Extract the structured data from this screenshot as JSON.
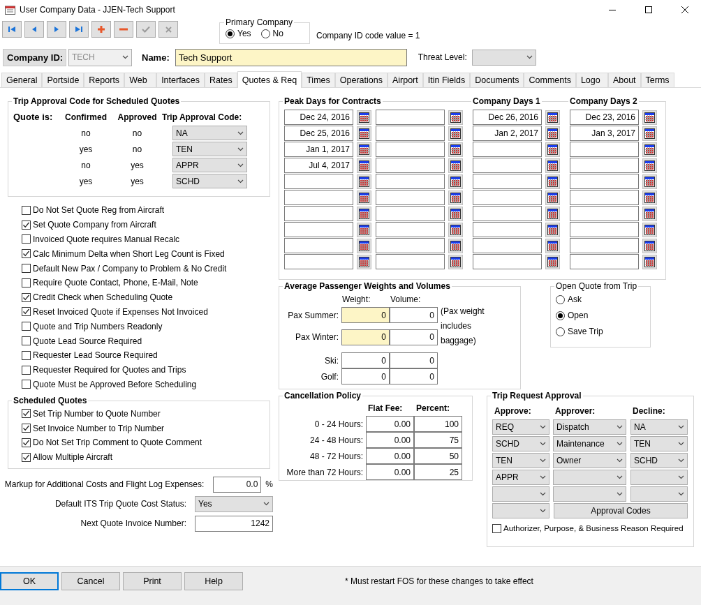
{
  "window": {
    "title": "User Company Data - JJEN-Tech Support"
  },
  "toolbar": [
    {
      "kind": "first",
      "disabled": false
    },
    {
      "kind": "previous",
      "disabled": false
    },
    {
      "kind": "next",
      "disabled": false
    },
    {
      "kind": "last",
      "disabled": false
    },
    {
      "kind": "add",
      "disabled": false
    },
    {
      "kind": "delete",
      "disabled": false
    },
    {
      "kind": "save",
      "disabled": true
    },
    {
      "kind": "cancel",
      "disabled": true
    }
  ],
  "primary_company": {
    "title": "Primary Company",
    "options": [
      {
        "label": "Yes",
        "selected": true
      },
      {
        "label": "No",
        "selected": false
      }
    ]
  },
  "company_id_code": "Company ID code value = 1",
  "company_id": {
    "label": "Company ID:",
    "value": "TECH",
    "disabled": true
  },
  "name": {
    "label": "Name:",
    "value": "Tech Support"
  },
  "threat_level": {
    "label": "Threat Level:"
  },
  "tabs": [
    {
      "label": "General",
      "selected": false
    },
    {
      "label": "Portside",
      "selected": false
    },
    {
      "label": "Reports",
      "selected": false
    },
    {
      "label": "Web",
      "selected": false
    },
    {
      "label": "Interfaces",
      "selected": false
    },
    {
      "label": "Rates",
      "selected": false
    },
    {
      "label": "Quotes & Req",
      "selected": true
    },
    {
      "label": "Times",
      "selected": false
    },
    {
      "label": "Operations",
      "selected": false
    },
    {
      "label": "Airport",
      "selected": false
    },
    {
      "label": "Itin Fields",
      "selected": false
    },
    {
      "label": "Documents",
      "selected": false
    },
    {
      "label": "Comments",
      "selected": false
    },
    {
      "label": "Logo",
      "selected": false
    },
    {
      "label": "About",
      "selected": false
    },
    {
      "label": "Terms",
      "selected": false
    }
  ],
  "trip_approval": {
    "title": "Trip Approval Code for Scheduled Quotes",
    "headers": [
      "Quote is:",
      "Confirmed",
      "Approved",
      "Trip Approval Code:"
    ],
    "rows": [
      {
        "confirmed": "no",
        "approved": "no",
        "code": "NA"
      },
      {
        "confirmed": "yes",
        "approved": "no",
        "code": "TEN"
      },
      {
        "confirmed": "no",
        "approved": "yes",
        "code": "APPR"
      },
      {
        "confirmed": "yes",
        "approved": "yes",
        "code": "SCHD"
      }
    ]
  },
  "options": [
    {
      "label": "Do Not Set Quote Reg from Aircraft",
      "checked": false
    },
    {
      "label": "Set Quote Company from Aircraft",
      "checked": true
    },
    {
      "label": "Invoiced Quote requires Manual Recalc",
      "checked": false
    },
    {
      "label": "Calc Minimum Delta when Short Leg Count is Fixed",
      "checked": true
    },
    {
      "label": "Default New Pax / Company to Problem & No Credit",
      "checked": false
    },
    {
      "label": "Require Quote Contact, Phone, E-Mail, Note",
      "checked": false
    },
    {
      "label": "Credit Check when Scheduling Quote",
      "checked": true
    },
    {
      "label": "Reset Invoiced Quote if Expenses Not Invoiced",
      "checked": true
    },
    {
      "label": "Quote and Trip Numbers Readonly",
      "checked": false
    },
    {
      "label": "Quote Lead Source Required",
      "checked": false
    },
    {
      "label": "Requester Lead Source Required",
      "checked": false
    },
    {
      "label": "Requester Required for Quotes and Trips",
      "checked": false
    },
    {
      "label": "Quote Must be Approved Before Scheduling",
      "checked": false
    }
  ],
  "scheduled_quotes": {
    "title": "Scheduled Quotes",
    "options": [
      {
        "label": "Set Trip Number to Quote Number",
        "checked": true
      },
      {
        "label": "Set Invoice Number to Trip Number",
        "checked": true
      },
      {
        "label": "Do Not Set Trip Comment to Quote Comment",
        "checked": true
      },
      {
        "label": "Allow Multiple Aircraft",
        "checked": true
      }
    ]
  },
  "markup": {
    "label": "Markup for Additional Costs and Flight Log Expenses:",
    "value": "0.0",
    "unit": "%"
  },
  "default_its_status": {
    "label": "Default ITS Trip Quote Cost Status:",
    "value": "Yes"
  },
  "next_invoice": {
    "label": "Next Quote Invoice Number:",
    "value": "1242"
  },
  "day_groups": [
    {
      "title": "Peak Days for Contracts",
      "columns": [
        {
          "kind": "dates",
          "dates": [
            "Dec 24, 2016",
            "Dec 25, 2016",
            "Jan 1, 2017",
            "Jul 4, 2017"
          ]
        },
        {
          "kind": "dates"
        }
      ]
    },
    {
      "title": "Company Days 1",
      "columns": [
        {
          "kind": "dates",
          "dates": [
            "Dec 26, 2016",
            "Jan 2, 2017"
          ]
        }
      ]
    },
    {
      "title": "Company Days 2",
      "columns": [
        {
          "kind": "dates",
          "dates": [
            "Dec 23, 2016",
            "Jan 3, 2017"
          ]
        }
      ]
    }
  ],
  "passenger_weights": {
    "title": "Average Passenger Weights and Volumes",
    "headers": [
      "Weight:",
      "Volume:"
    ],
    "note": "(Pax weight includes baggage)",
    "rows": [
      {
        "label": "Pax Summer:",
        "weight": "0",
        "volume": "0",
        "highlighted": true
      },
      {
        "label": "Pax Winter:",
        "weight": "0",
        "volume": "0",
        "highlighted": true
      },
      {
        "label": "Ski:",
        "weight": "0",
        "volume": "0",
        "highlighted": false
      },
      {
        "label": "Golf:",
        "weight": "0",
        "volume": "0",
        "highlighted": false
      }
    ]
  },
  "open_quote": {
    "title": "Open Quote from Trip",
    "options": [
      {
        "label": "Ask",
        "selected": false
      },
      {
        "label": "Open",
        "selected": true
      },
      {
        "label": "Save Trip",
        "selected": false
      }
    ]
  },
  "cancellation": {
    "title": "Cancellation Policy",
    "headers": [
      "Flat Fee:",
      "Percent:"
    ],
    "rows": [
      {
        "label": "0 - 24 Hours:",
        "fee": "0.00",
        "percent": "100"
      },
      {
        "label": "24 - 48 Hours:",
        "fee": "0.00",
        "percent": "75"
      },
      {
        "label": "48 -  72 Hours:",
        "fee": "0.00",
        "percent": "50"
      },
      {
        "label": "More than 72 Hours:",
        "fee": "0.00",
        "percent": "25"
      }
    ]
  },
  "trip_request": {
    "title": "Trip Request Approval",
    "columns": [
      {
        "header": "Approve:",
        "combos": [
          {
            "kind": "combo",
            "value": "REQ"
          },
          {
            "kind": "combo",
            "value": "SCHD"
          },
          {
            "kind": "combo",
            "value": "TEN"
          },
          {
            "kind": "combo",
            "value": "APPR"
          },
          {
            "kind": "combo"
          },
          {
            "kind": "combo"
          }
        ]
      },
      {
        "header": "Approver:",
        "combos": [
          {
            "kind": "combo",
            "value": "Dispatch"
          },
          {
            "kind": "combo",
            "value": "Maintenance"
          },
          {
            "kind": "combo",
            "value": "Owner"
          },
          {
            "kind": "combo"
          },
          {
            "kind": "combo"
          }
        ]
      },
      {
        "header": "Decline:",
        "combos": [
          {
            "kind": "combo",
            "value": "NA"
          },
          {
            "kind": "combo",
            "value": "TEN"
          },
          {
            "kind": "combo",
            "value": "SCHD"
          },
          {
            "kind": "combo"
          },
          {
            "kind": "combo"
          }
        ]
      }
    ],
    "button": "Approval Codes",
    "checkbox": {
      "label": "Authorizer, Purpose, & Business Reason Required",
      "checked": false
    }
  },
  "buttons": [
    {
      "label": "OK",
      "default": true
    },
    {
      "label": "Cancel",
      "default": false
    },
    {
      "label": "Print",
      "default": false
    },
    {
      "label": "Help",
      "default": false
    }
  ],
  "footer_note": "* Must restart FOS for these changes to take effect"
}
